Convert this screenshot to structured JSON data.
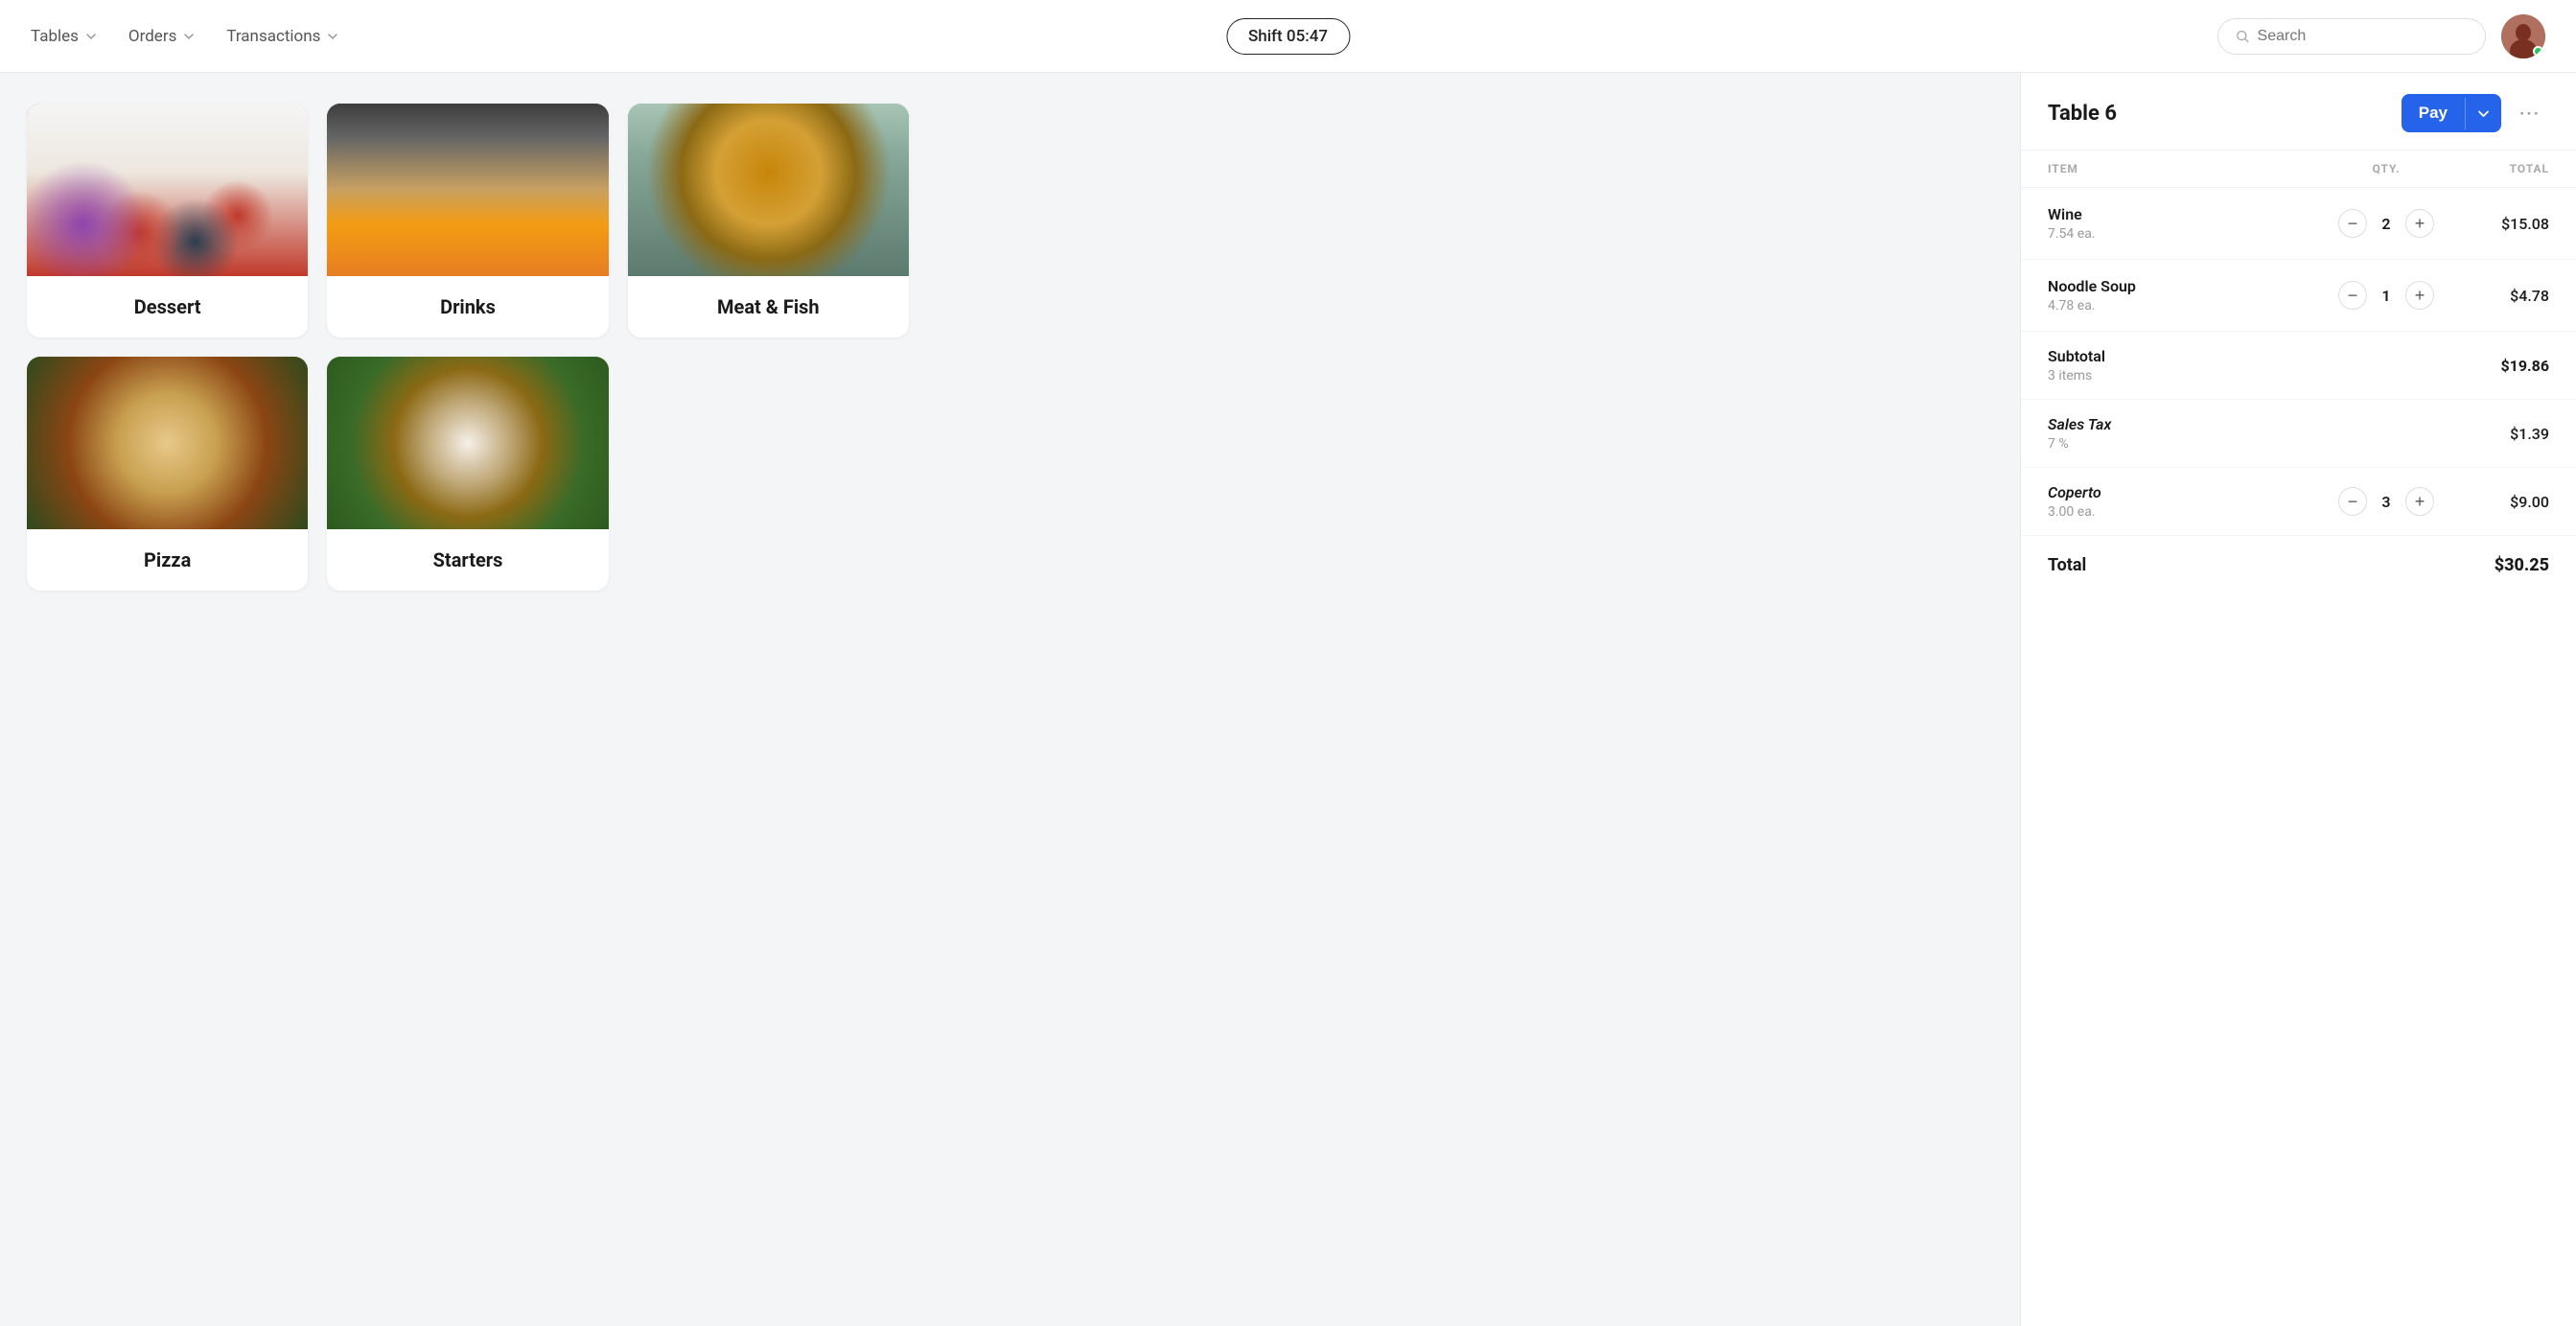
{
  "header": {
    "nav": [
      {
        "label": "Tables",
        "id": "tables"
      },
      {
        "label": "Orders",
        "id": "orders"
      },
      {
        "label": "Transactions",
        "id": "transactions"
      }
    ],
    "shift": "Shift 05:47",
    "search_placeholder": "Search"
  },
  "categories": [
    {
      "id": "dessert",
      "label": "Dessert",
      "img_class": "img-dessert"
    },
    {
      "id": "drinks",
      "label": "Drinks",
      "img_class": "img-drinks"
    },
    {
      "id": "meat-fish",
      "label": "Meat & Fish",
      "img_class": "img-meatfish"
    },
    {
      "id": "pizza",
      "label": "Pizza",
      "img_class": "img-pizza"
    },
    {
      "id": "starters",
      "label": "Starters",
      "img_class": "img-starters"
    }
  ],
  "order_panel": {
    "table_title": "Table 6",
    "pay_label": "Pay",
    "columns": {
      "item": "ITEM",
      "qty": "QTY.",
      "total": "TOTAL"
    },
    "items": [
      {
        "name": "Wine",
        "price_each": "7.54 ea.",
        "qty": 2,
        "total": "$15.08"
      },
      {
        "name": "Noodle Soup",
        "price_each": "4.78 ea.",
        "qty": 1,
        "total": "$4.78"
      }
    ],
    "subtotal": {
      "label": "Subtotal",
      "sublabel": "3 items",
      "value": "$19.86"
    },
    "sales_tax": {
      "label": "Sales Tax",
      "sublabel": "7 %",
      "value": "$1.39"
    },
    "coperto": {
      "label": "Coperto",
      "price_each": "3.00 ea.",
      "qty": 3,
      "total": "$9.00"
    },
    "total": {
      "label": "Total",
      "value": "$30.25"
    }
  }
}
